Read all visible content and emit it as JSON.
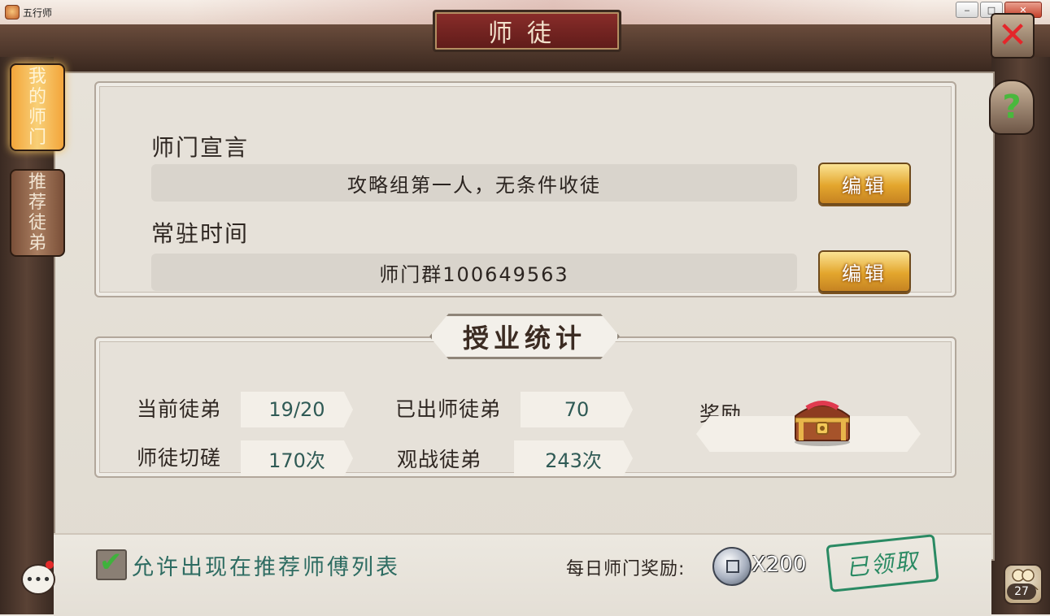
{
  "window": {
    "title": "五行师",
    "minimize_glyph": "‒",
    "maximize_glyph": "□",
    "close_glyph": "✕"
  },
  "panel": {
    "title": "师徒",
    "close_icon": "red-x-icon",
    "help_icon": "question-icon"
  },
  "tabs": [
    {
      "label": [
        "我",
        "的",
        "师",
        "门"
      ],
      "active": true
    },
    {
      "label": [
        "推",
        "荐",
        "徒",
        "弟"
      ],
      "active": false
    }
  ],
  "info": {
    "declaration_label": "师门宣言",
    "declaration_value": "攻略组第一人，无条件收徒",
    "hours_label": "常驻时间",
    "hours_value": "师门群100649563",
    "edit_label": "编辑"
  },
  "stats": {
    "title": "授业统计",
    "current_disciples_label": "当前徒弟",
    "current_disciples_value": "19/20",
    "graduated_label": "已出师徒弟",
    "graduated_value": "70",
    "sparring_label": "师徒切磋",
    "sparring_value": "170次",
    "watched_label": "观战徒弟",
    "watched_value": "243次",
    "reward_label": "奖励",
    "reward_icon": "treasure-chest-icon"
  },
  "bottom": {
    "allow_label": "允许出现在推荐师傅列表",
    "allow_checked": true,
    "daily_label": "每日师门奖励:",
    "coin_icon": "silver-coin-icon",
    "coin_count": "X200",
    "claimed_stamp": "已领取",
    "chat_icon": "chat-bubble-icon",
    "friends_icon": "friends-icon",
    "friends_count": "27"
  },
  "colors": {
    "accent_gold": "#e3a62d",
    "stat_value": "#2f5a55",
    "checkbox_green": "#3fb23c",
    "stamp_green": "#2a8a63",
    "close_red": "#e4262a"
  }
}
